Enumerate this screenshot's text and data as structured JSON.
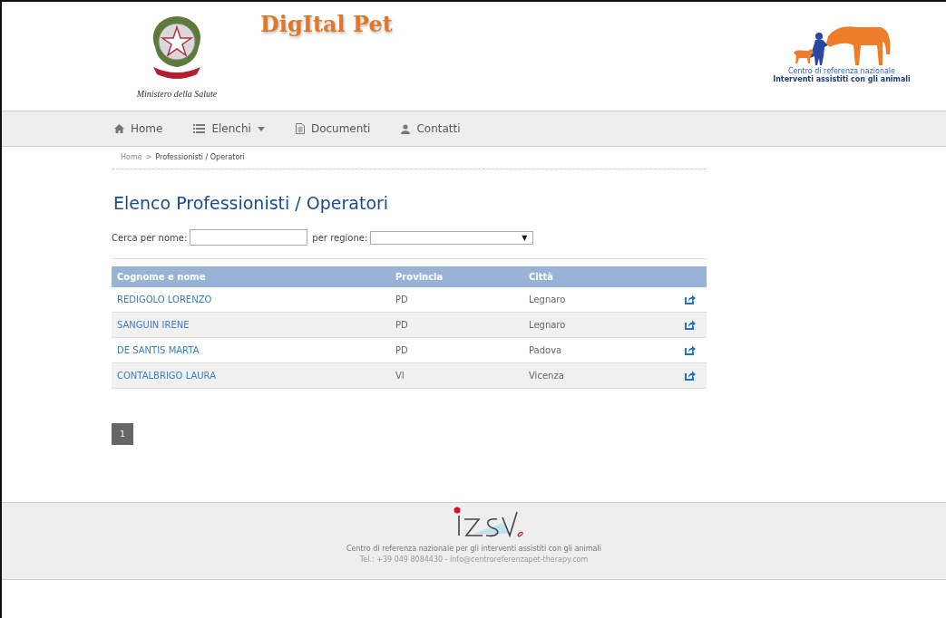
{
  "header": {
    "ministry_caption": "Ministero della Salute",
    "site_title": "DigItal Pet",
    "partner_logo": {
      "line_1": "Centro di referenza nazionale",
      "line_2": "Interventi assistiti con gli animali"
    }
  },
  "nav": [
    {
      "label": "Home",
      "kind": "home",
      "dropdown": false
    },
    {
      "label": "Elenchi",
      "kind": "list",
      "dropdown": true
    },
    {
      "label": "Documenti",
      "kind": "document",
      "dropdown": false
    },
    {
      "label": "Contatti",
      "kind": "user",
      "dropdown": false
    }
  ],
  "breadcrumb": [
    {
      "label": "Home"
    },
    {
      "label": "Professionisti / Operatori"
    }
  ],
  "breadcrumb_separator": ">",
  "page_title": "Elenco Professionisti / Operatori",
  "filters": {
    "name_label": "Cerca per nome:",
    "region_label": "per regione:",
    "region_arrow": "▼"
  },
  "table": {
    "columns": [
      "Cognome e nome",
      "Provincia",
      "Città"
    ],
    "rows": [
      {
        "name": "REDIGOLO LORENZO",
        "provincia": "PD",
        "citta": "Legnaro"
      },
      {
        "name": "SANGUIN IRENE",
        "provincia": "PD",
        "citta": "Legnaro"
      },
      {
        "name": "DE SANTIS MARTA",
        "provincia": "PD",
        "citta": "Padova"
      },
      {
        "name": "CONTALBRIGO LAURA",
        "provincia": "VI",
        "citta": "Vicenza"
      }
    ]
  },
  "pagination": [
    {
      "label": "1",
      "selected": true
    }
  ],
  "footer": {
    "line_1": "Centro di referenza nazionale per gli interventi assistiti con gli animali",
    "line_2": "Tel.: +39 049 8084430 - info@centroreferenzapet-therapy.com"
  }
}
